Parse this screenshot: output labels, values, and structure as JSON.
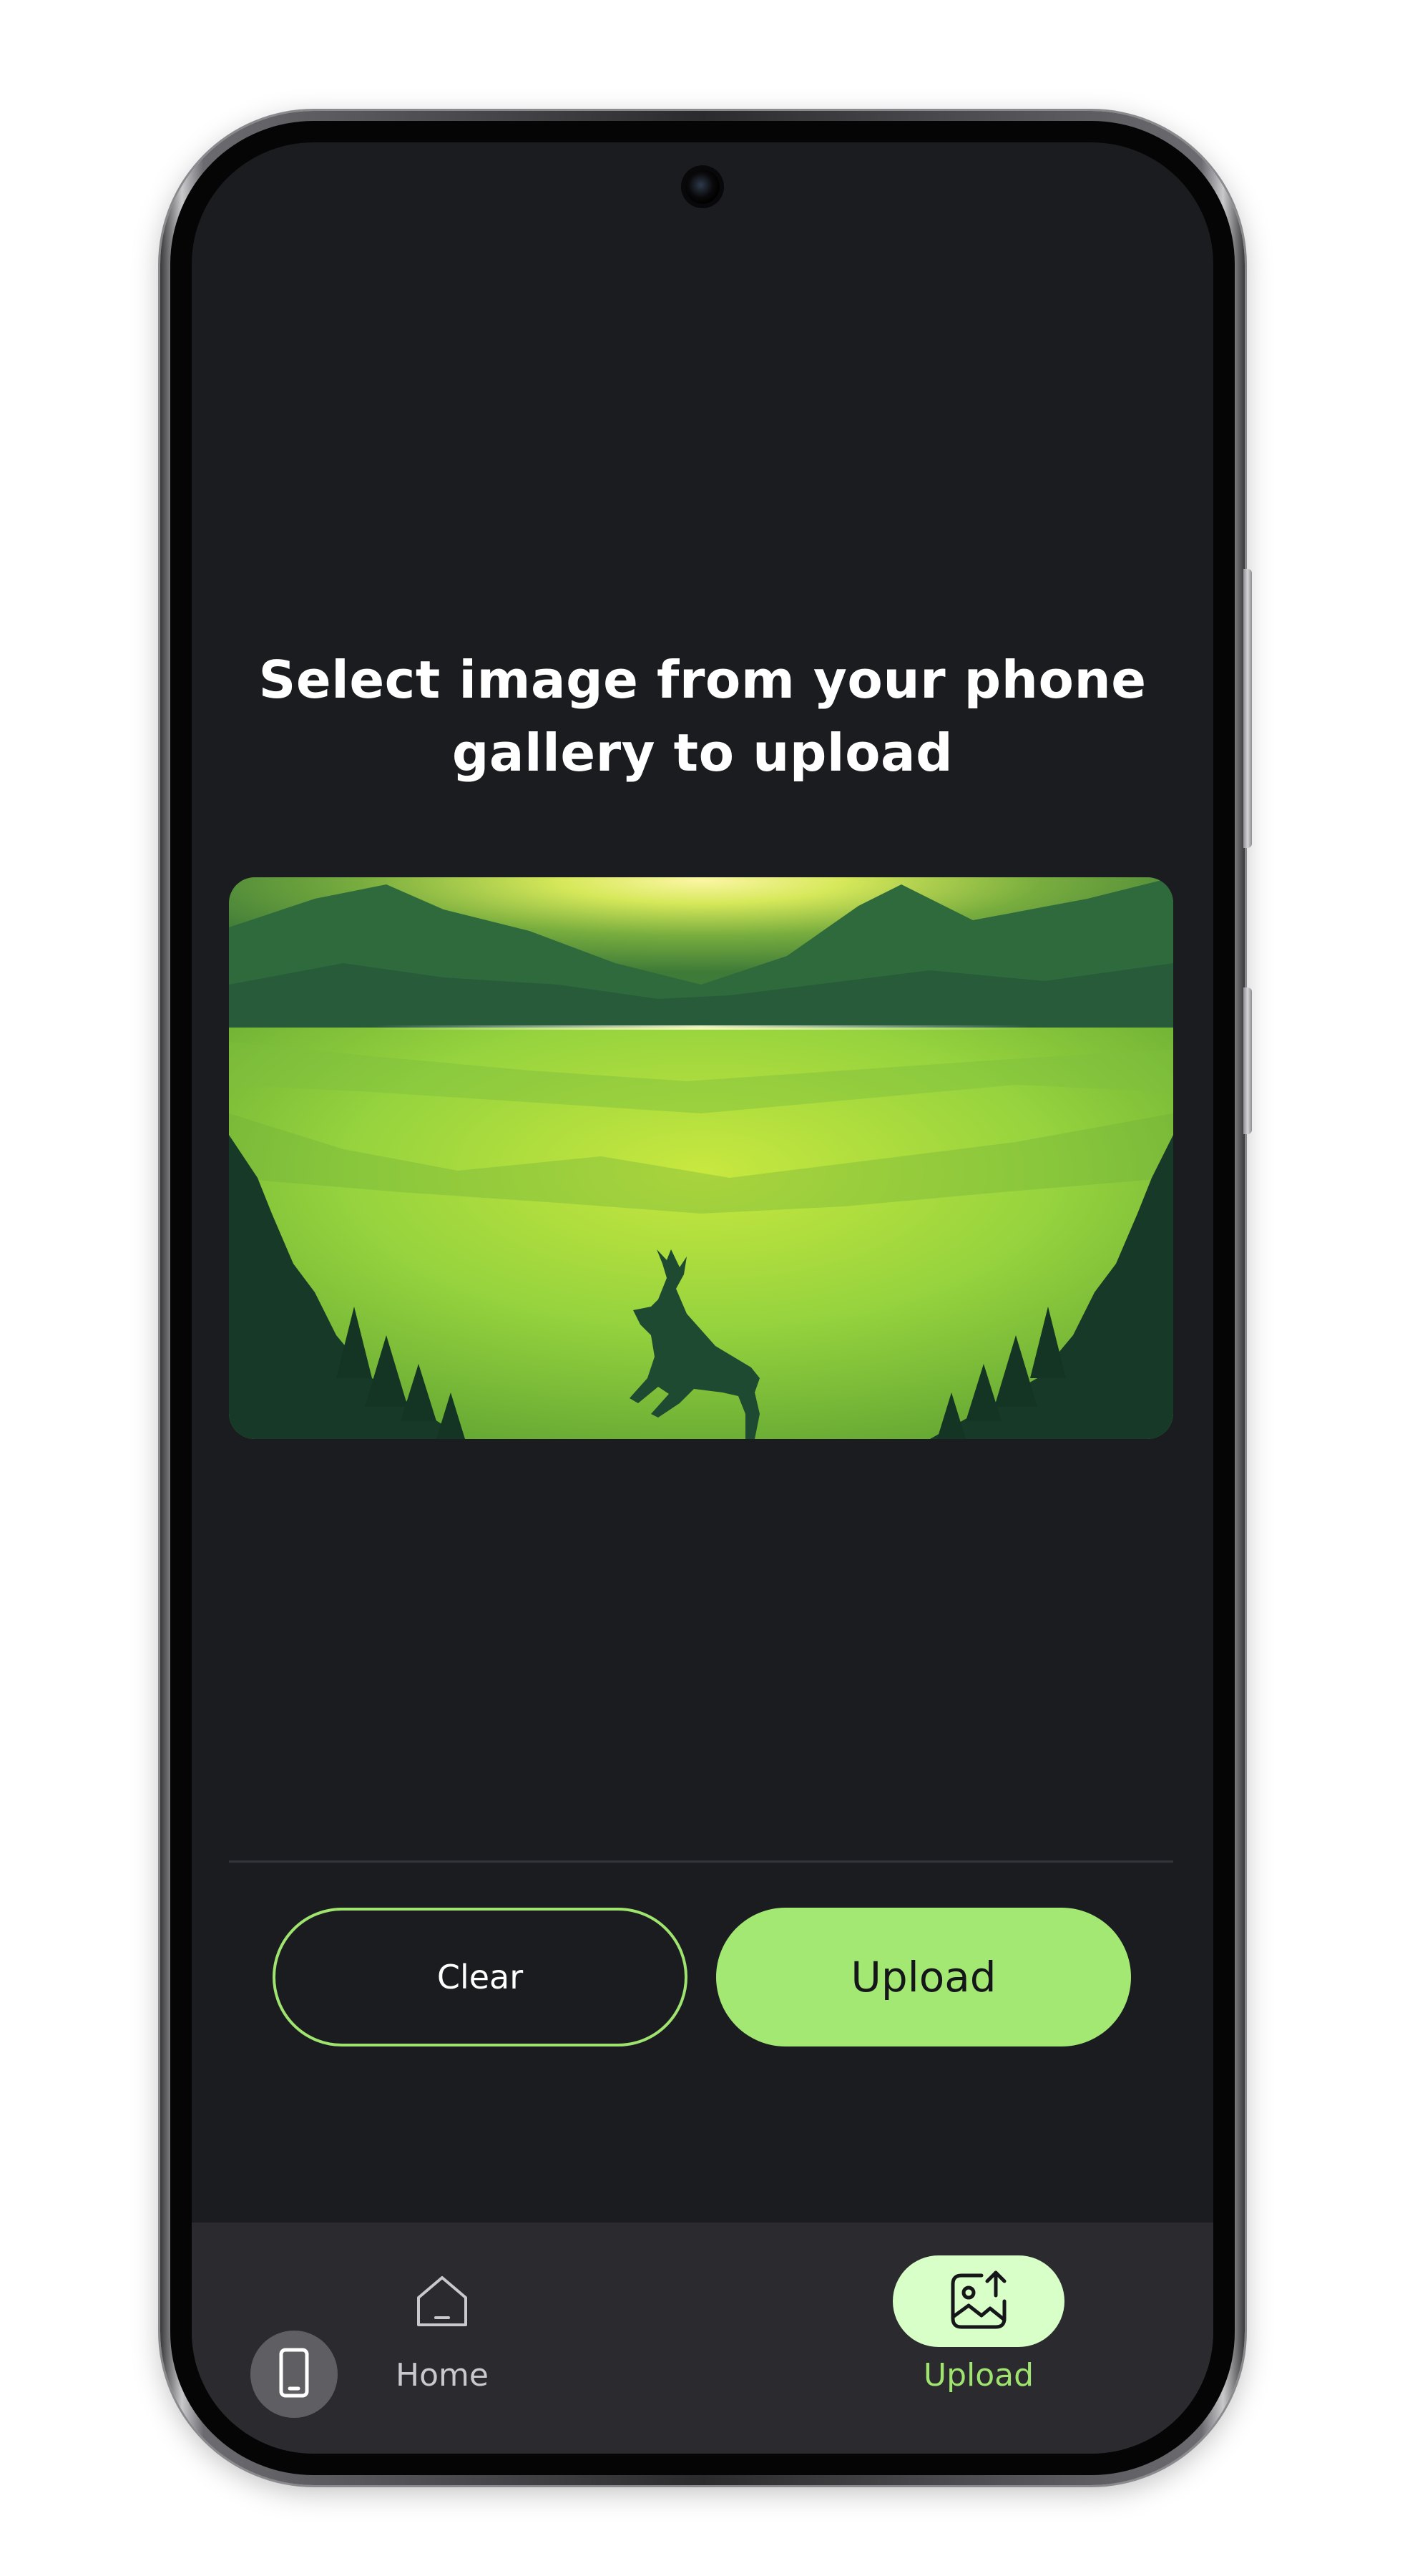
{
  "colors": {
    "background": "#1b1c20",
    "accent": "#a2e872",
    "accent_outline": "#9fe46e",
    "nav_background": "#2a2a2f",
    "nav_active_pill": "#d8ffc8"
  },
  "main": {
    "title_line1": "Select image from your phone",
    "title_line2": "gallery to upload",
    "preview_image": {
      "icon": "landscape-deer-illustration"
    }
  },
  "actions": {
    "clear_label": "Clear",
    "upload_label": "Upload"
  },
  "bottom_nav": {
    "items": [
      {
        "label": "Home",
        "icon": "home-icon",
        "active": false
      },
      {
        "label": "Upload",
        "icon": "image-upload-icon",
        "active": true
      }
    ]
  },
  "floating_button": {
    "icon": "phone-device-icon"
  }
}
